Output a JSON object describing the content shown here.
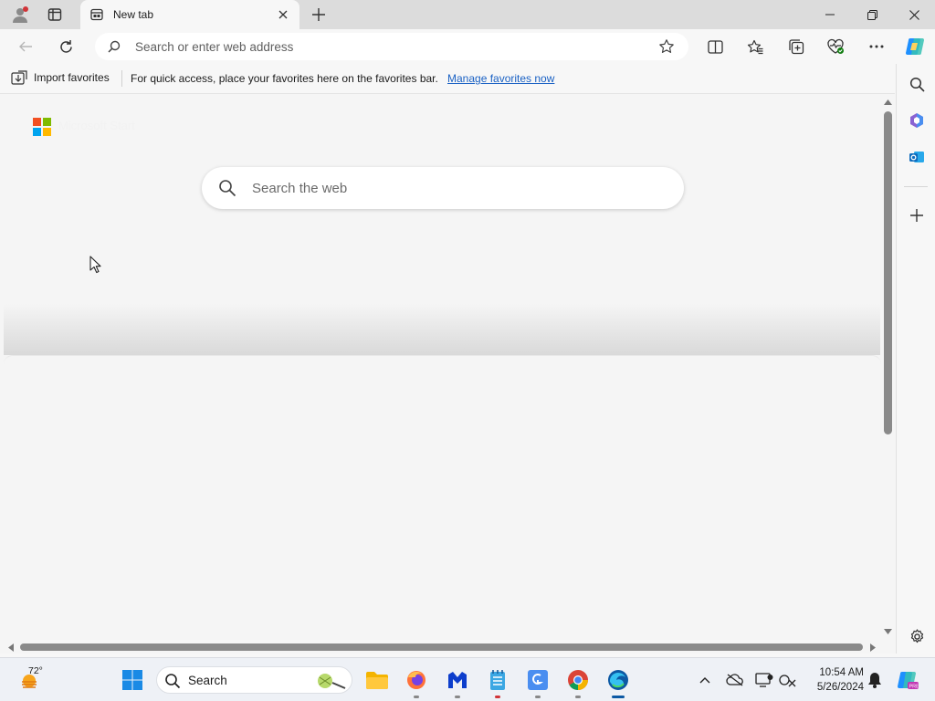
{
  "browser": {
    "tab": {
      "title": "New tab"
    },
    "address_bar": {
      "placeholder": "Search or enter web address"
    },
    "favorites_bar": {
      "import_label": "Import favorites",
      "message": "For quick access, place your favorites here on the favorites bar.",
      "manage_link": "Manage favorites now"
    }
  },
  "page": {
    "brand": "Microsoft Start",
    "search": {
      "placeholder": "Search the web"
    }
  },
  "taskbar": {
    "weather_temp": "72°",
    "search_label": "Search",
    "clock": {
      "time": "10:54 AM",
      "date": "5/26/2024"
    }
  },
  "colors": {
    "accent": "#1a61c4",
    "ms_red": "#f25022",
    "ms_green": "#7fba00",
    "ms_blue": "#00a4ef",
    "ms_yellow": "#ffb900"
  },
  "icons": {
    "profile": "profile-icon",
    "workspaces": "workspaces-icon",
    "favorites": "favorites-icon",
    "collections": "collections-icon",
    "copilot": "copilot-icon"
  }
}
